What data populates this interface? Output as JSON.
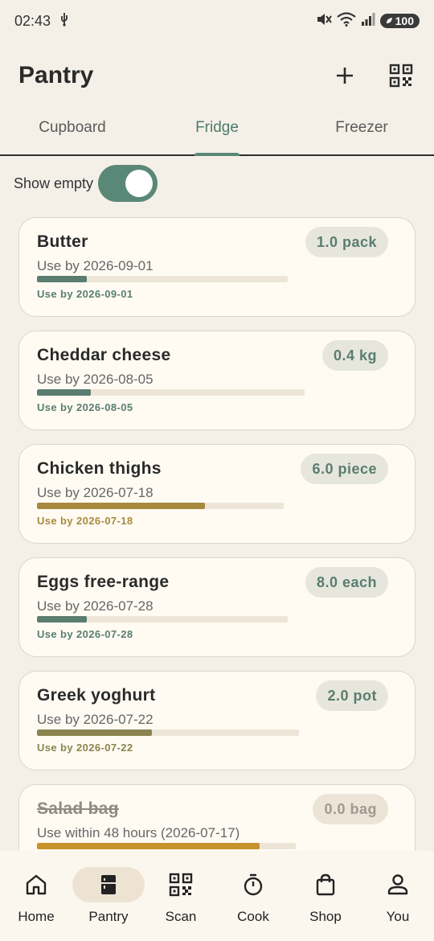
{
  "status_bar": {
    "time": "02:43",
    "battery": "100"
  },
  "app_bar": {
    "title": "Pantry"
  },
  "tabs": [
    {
      "label": "Cupboard",
      "active": false
    },
    {
      "label": "Fridge",
      "active": true
    },
    {
      "label": "Freezer",
      "active": false
    }
  ],
  "show_empty": {
    "label": "Show empty",
    "on": true
  },
  "items": [
    {
      "name": "Butter",
      "qty": "1.0 pack",
      "use_line": "Use by 2026-09-01",
      "use_bold": "Use by 2026-09-01",
      "progress": 0.2,
      "color": "#5a7d70",
      "empty": false
    },
    {
      "name": "Cheddar cheese",
      "qty": "0.4 kg",
      "use_line": "Use by 2026-08-05",
      "use_bold": "Use by 2026-08-05",
      "progress": 0.2,
      "color": "#5a7d70",
      "empty": false
    },
    {
      "name": "Chicken thighs",
      "qty": "6.0 piece",
      "use_line": "Use by 2026-07-18",
      "use_bold": "Use by 2026-07-18",
      "progress": 0.68,
      "color": "#a88a3e",
      "empty": false
    },
    {
      "name": "Eggs free-range",
      "qty": "8.0 each",
      "use_line": "Use by 2026-07-28",
      "use_bold": "Use by 2026-07-28",
      "progress": 0.2,
      "color": "#5a7d70",
      "empty": false
    },
    {
      "name": "Greek yoghurt",
      "qty": "2.0 pot",
      "use_line": "Use by 2026-07-22",
      "use_bold": "Use by 2026-07-22",
      "progress": 0.44,
      "color": "#8c8450",
      "empty": false
    },
    {
      "name": "Salad bag",
      "qty": "0.0 bag",
      "use_line": "Use within 48 hours (2026-07-17)",
      "use_bold": "",
      "progress": 0.86,
      "color": "#c8922c",
      "empty": true
    }
  ],
  "bottom_nav": [
    {
      "label": "Home",
      "icon": "home-icon",
      "active": false
    },
    {
      "label": "Pantry",
      "icon": "fridge-icon",
      "active": true
    },
    {
      "label": "Scan",
      "icon": "qr-scan-icon",
      "active": false
    },
    {
      "label": "Cook",
      "icon": "timer-icon",
      "active": false
    },
    {
      "label": "Shop",
      "icon": "shopping-bag-icon",
      "active": false
    },
    {
      "label": "You",
      "icon": "person-icon",
      "active": false
    }
  ]
}
